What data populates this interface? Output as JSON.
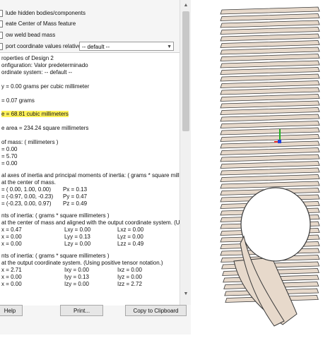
{
  "options": {
    "include_hidden": "lude hidden bodies/components",
    "create_com": "eate Center of Mass feature",
    "show_weld": "ow weld bead mass",
    "report_relative": "port coordinate values relative to:",
    "relative_select": "-- default --"
  },
  "results": {
    "properties_title": "roperties of Design 2",
    "configuration": "onfiguration: Valor predeterminado",
    "coord_system": "ordinate system: -- default --",
    "density": "y = 0.00 grams per cubic millimeter",
    "mass": "= 0.07 grams",
    "volume": "e = 68.81 cubic millimeters",
    "surface_area": "e area = 234.24  square millimeters",
    "com_title": "of mass: ( millimeters )",
    "com_x": "= 0.00",
    "com_y": "= 5.70",
    "com_z": "= 0.00",
    "principal_title": "al axes of inertia and principal moments of inertia: ( grams *  square millimeters )",
    "principal_sub": "at the center of mass.",
    "ix": "= ( 0.00,  1.00,  0.00)",
    "iy": "= (-0.97,  0.00, -0.23)",
    "iz": "= (-0.23,  0.00,  0.97)",
    "px": "Px = 0.13",
    "py": "Py = 0.47",
    "pz": "Pz = 0.49",
    "moments1_title": "nts of inertia: ( grams *  square millimeters )",
    "moments1_sub": "at the center of mass and aligned with the output coordinate system. (Using positi",
    "m1": [
      [
        "x = 0.47",
        "Lxy = 0.00",
        "Lxz = 0.00"
      ],
      [
        "x = 0.00",
        "Lyy = 0.13",
        "Lyz = 0.00"
      ],
      [
        "x = 0.00",
        "Lzy = 0.00",
        "Lzz = 0.49"
      ]
    ],
    "moments2_title": "nts of inertia: ( grams *  square millimeters )",
    "moments2_sub": "at the output coordinate system. (Using positive tensor notation.)",
    "m2": [
      [
        "x = 2.71",
        "Ixy = 0.00",
        "Ixz = 0.00"
      ],
      [
        "x = 0.00",
        "Iyy = 0.13",
        "Iyz = 0.00"
      ],
      [
        "x = 0.00",
        "Izy = 0.00",
        "Izz = 2.72"
      ]
    ]
  },
  "buttons": {
    "help": "Help",
    "print": "Print...",
    "copy": "Copy to Clipboard"
  },
  "colors": {
    "highlight": "#fff25a",
    "part_fill": "#e7d9cb",
    "part_stroke": "#3a3a3a",
    "axis_x": "#e02020",
    "axis_y": "#20b020",
    "axis_z": "#2040e0"
  },
  "icons": {
    "scroll_up": "▲",
    "scroll_down": "▼",
    "dropdown": "▼"
  }
}
